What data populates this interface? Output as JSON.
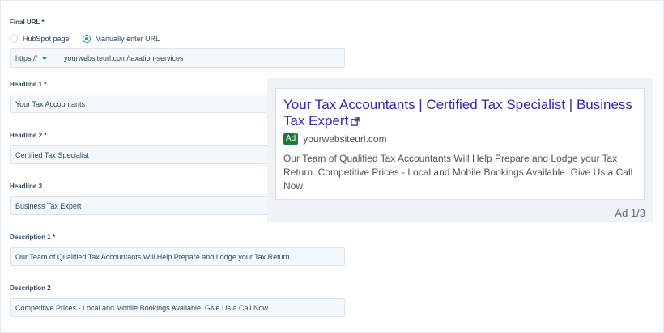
{
  "form": {
    "final_url_label": "Final URL *",
    "radio_hubspot": "HubSpot page",
    "radio_manual": "Manually enter URL",
    "protocol": "https://",
    "url_value": "yourwebsiteurl.com/taxation-services",
    "headline1_label": "Headline 1 *",
    "headline1_value": "Your Tax Accountants",
    "headline2_label": "Headline 2 *",
    "headline2_value": "Certified Tax Specialist",
    "headline3_label": "Headline 3",
    "headline3_value": "Business Tax Expert",
    "description1_label": "Description 1 *",
    "description1_value": "Our Team of Qualified Tax Accountants Will Help Prepare and Lodge your Tax Return.",
    "description2_label": "Description 2",
    "description2_value": "Competitive Prices - Local and Mobile Bookings Available. Give Us a Call Now."
  },
  "preview": {
    "title": "Your Tax Accountants | Certified Tax Specialist | Business Tax Expert",
    "ad_badge": "Ad",
    "display_url": "yourwebsiteurl.com",
    "description": "Our Team of Qualified Tax Accountants Will Help Prepare and Lodge your Tax Return. Competitive Prices - Local and Mobile Bookings Available. Give Us a Call Now.",
    "counter": "Ad 1/3"
  },
  "colors": {
    "accent": "#00a4bd",
    "ad_title": "#3c24b2",
    "ad_badge": "#1b7b3d"
  }
}
